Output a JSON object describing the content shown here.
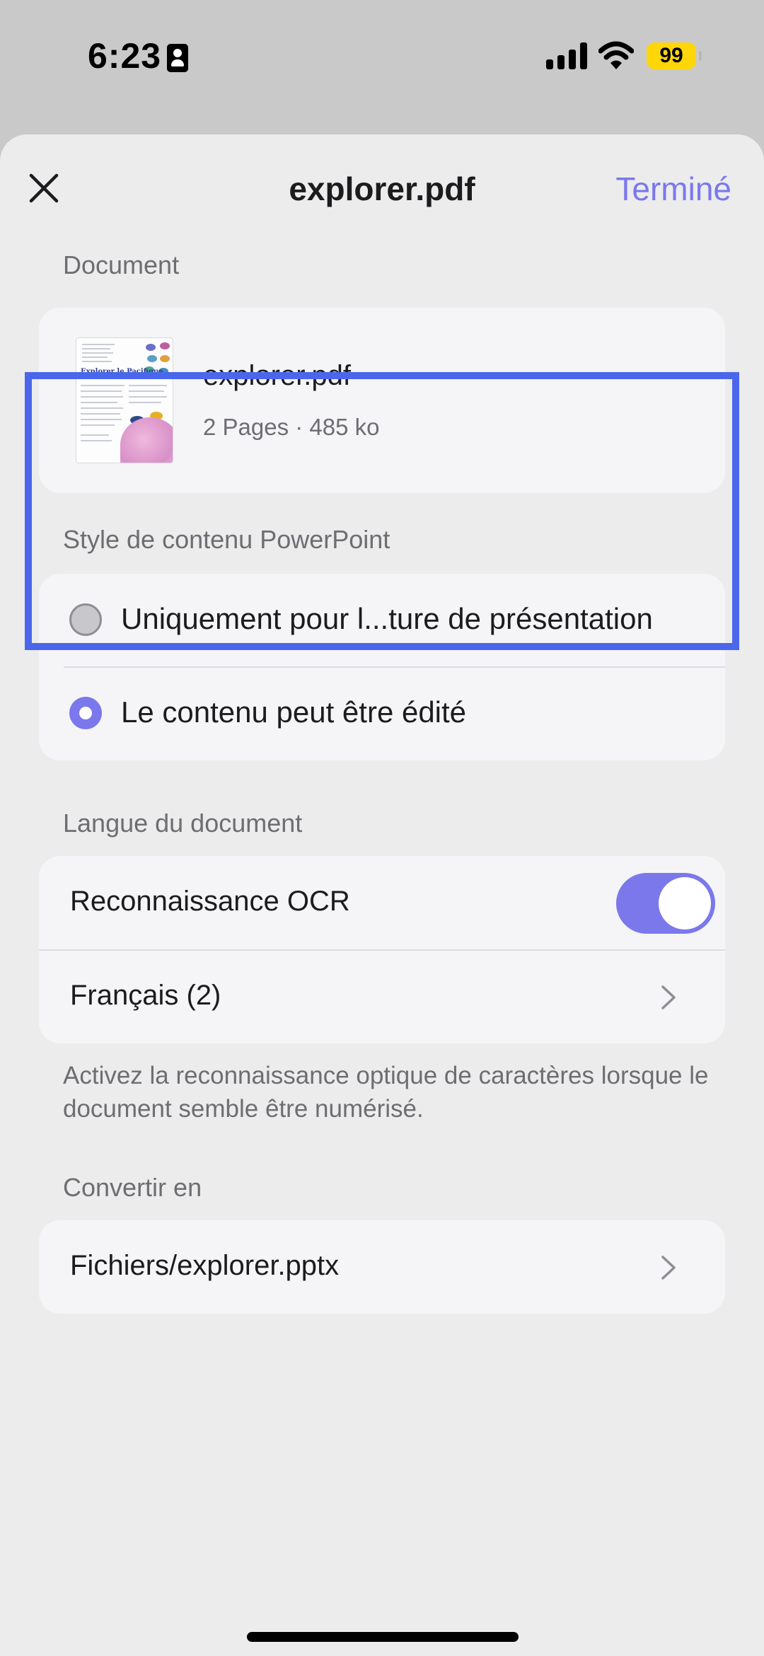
{
  "status_bar": {
    "time": "6:23",
    "battery": "99"
  },
  "header": {
    "title": "explorer.pdf",
    "done_label": "Terminé"
  },
  "document_section": {
    "label": "Document",
    "file_name": "explorer.pdf",
    "meta": "2 Pages · 485 ko",
    "thumbnail_title": "Explorer le Pacifique"
  },
  "style_section": {
    "label": "Style de contenu PowerPoint",
    "options": [
      {
        "label": "Uniquement pour l...ture de présentation",
        "selected": false
      },
      {
        "label": "Le contenu peut être édité",
        "selected": true
      }
    ]
  },
  "language_section": {
    "label": "Langue du document",
    "ocr_label": "Reconnaissance OCR",
    "ocr_enabled": true,
    "language_value": "Français (2)",
    "helper_text": "Activez la reconnaissance optique de caractères lorsque le document semble être numérisé."
  },
  "convert_section": {
    "label": "Convertir en",
    "path": "Fichiers/explorer.pptx"
  },
  "colors": {
    "accent": "#7b78ec",
    "highlight": "#4a67ec",
    "battery": "#ffd60a"
  }
}
